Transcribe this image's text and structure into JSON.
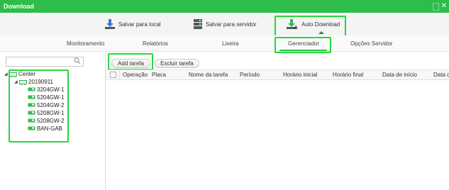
{
  "window": {
    "title": "Download"
  },
  "toolbar": {
    "save_local": "Salvar para local",
    "save_server": "Salvar para servidor",
    "auto_download": "Auto Download"
  },
  "tabs": {
    "monitoramento": "Monitoramento",
    "relatorios": "Relatórios",
    "lixeira": "Lixeira",
    "gerenciador": "Gerenciador",
    "opcoes_servidor": "Opções Servidor"
  },
  "search": {
    "value": ""
  },
  "tree": {
    "root": "Center",
    "group": "20190911",
    "devices": [
      "3204GW-1",
      "5204GW-1",
      "5204GW-2",
      "5208GW-1",
      "5208GW-2",
      "BAN-GAB"
    ]
  },
  "actions": {
    "add_task": "Add tarefa",
    "delete_task": "Excluir tarefa"
  },
  "table": {
    "headers": [
      "Operação",
      "Placa",
      "Nome da tarefa",
      "Período",
      "Horário inicial",
      "Horário final",
      "Data de início",
      "Data d"
    ]
  },
  "colors": {
    "accent": "#2ebd4a",
    "highlight": "#23d93b"
  }
}
